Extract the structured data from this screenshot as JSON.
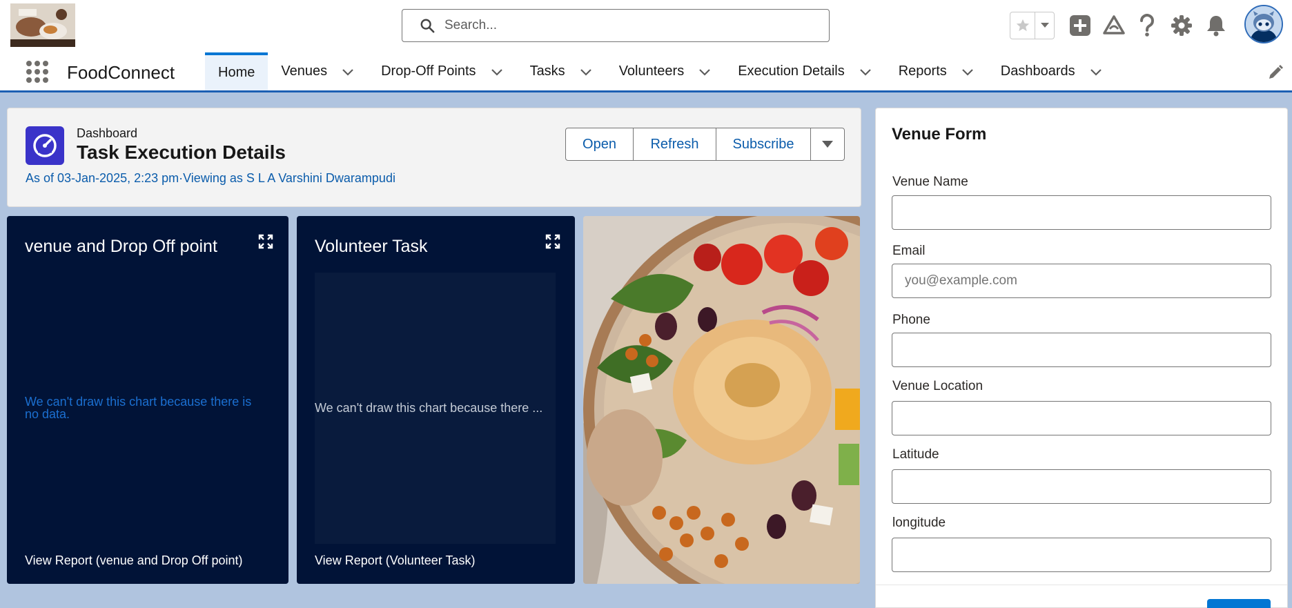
{
  "header": {
    "logo_alt": "FoodConnect logo",
    "search_placeholder": "Search...",
    "icons": [
      "star-icon",
      "chevron-down-icon",
      "add-icon",
      "trailhead-icon",
      "help-icon",
      "settings-icon",
      "bell-icon",
      "avatar-icon"
    ]
  },
  "nav": {
    "app_name": "FoodConnect",
    "tabs": [
      {
        "label": "Home",
        "active": true,
        "has_menu": false
      },
      {
        "label": "Venues",
        "active": false,
        "has_menu": true
      },
      {
        "label": "Drop-Off Points",
        "active": false,
        "has_menu": true
      },
      {
        "label": "Tasks",
        "active": false,
        "has_menu": true
      },
      {
        "label": "Volunteers",
        "active": false,
        "has_menu": true
      },
      {
        "label": "Execution Details",
        "active": false,
        "has_menu": true
      },
      {
        "label": "Reports",
        "active": false,
        "has_menu": true
      },
      {
        "label": "Dashboards",
        "active": false,
        "has_menu": true
      }
    ]
  },
  "dashboard": {
    "label": "Dashboard",
    "title": "Task Execution Details",
    "subtitle": "As of 03-Jan-2025, 2:23 pm·Viewing as S L A Varshini Dwarampudi",
    "buttons": {
      "open": "Open",
      "refresh": "Refresh",
      "subscribe": "Subscribe"
    }
  },
  "widgets": [
    {
      "title": "venue and Drop Off point",
      "message": "We can't draw this chart because there is no data.",
      "footer": "View Report (venue and Drop Off point)"
    },
    {
      "title": "Volunteer Task",
      "message": "We can't draw this chart because there ...",
      "footer": "View Report (Volunteer Task)"
    }
  ],
  "venue_form": {
    "title": "Venue Form",
    "fields": [
      {
        "label": "Venue Name",
        "value": "",
        "placeholder": ""
      },
      {
        "label": "Email",
        "value": "",
        "placeholder": "you@example.com"
      },
      {
        "label": "Phone",
        "value": "",
        "placeholder": ""
      },
      {
        "label": "Venue Location",
        "value": "",
        "placeholder": ""
      },
      {
        "label": "Latitude",
        "value": "",
        "placeholder": ""
      },
      {
        "label": "longitude",
        "value": "",
        "placeholder": ""
      }
    ]
  },
  "colors": {
    "brand_blue": "#0176d3",
    "link_blue": "#0b5cab",
    "widget_bg": "#011337",
    "dashboard_icon": "#3a33c9",
    "page_bg": "#b0c4df"
  }
}
